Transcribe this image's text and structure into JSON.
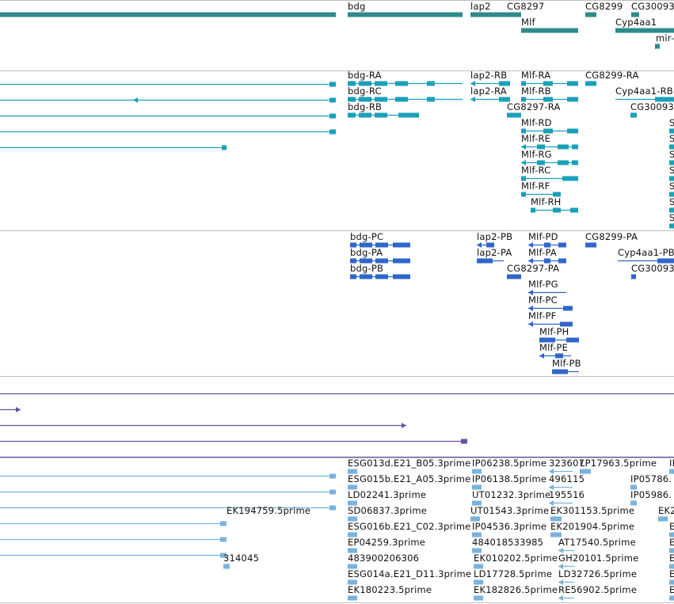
{
  "colors": {
    "gene": "#2e8b8b",
    "transcript": "#1aa0b8",
    "protein": "#2f66c9",
    "rnai": "#6a4fa5",
    "est": "#7ab2dd",
    "divider": "#bdbdbd"
  },
  "tracks": [
    {
      "id": "genes",
      "features": [
        {
          "label": "",
          "lbl": null
        },
        {
          "label": "bdg"
        },
        {
          "label": "lap2"
        },
        {
          "label": "CG8297"
        },
        {
          "label": "CG8299"
        },
        {
          "label": "CG30093"
        },
        {
          "label": "Mlf"
        },
        {
          "label": "Cyp4aa1"
        },
        {
          "label": "mir-"
        }
      ]
    },
    {
      "id": "transcripts",
      "features": [
        {
          "label": "bdg-RA"
        },
        {
          "label": "lap2-RB"
        },
        {
          "label": "Mlf-RA"
        },
        {
          "label": "CG8299-RA"
        },
        {
          "label": "bdg-RC"
        },
        {
          "label": "lap2-RA"
        },
        {
          "label": "Mlf-RB"
        },
        {
          "label": "Cyp4aa1-RB"
        },
        {
          "label": "bdg-RB"
        },
        {
          "label": "CG8297-RA"
        },
        {
          "label": "CG30093"
        },
        {
          "label": "Mlf-RD"
        },
        {
          "label": "Mlf-RE"
        },
        {
          "label": "Mlf-RG"
        },
        {
          "label": "Mlf-RC"
        },
        {
          "label": "Mlf-RF"
        },
        {
          "label": "Mlf-RH"
        },
        {
          "label": "S"
        },
        {
          "label": "S"
        },
        {
          "label": "S"
        },
        {
          "label": "S"
        },
        {
          "label": "S"
        },
        {
          "label": "S"
        },
        {
          "label": "S"
        }
      ]
    },
    {
      "id": "proteins",
      "features": [
        {
          "label": "bdg-PC"
        },
        {
          "label": "lap2-PB"
        },
        {
          "label": "Mlf-PD"
        },
        {
          "label": "CG8299-PA"
        },
        {
          "label": "bdg-PA"
        },
        {
          "label": "lap2-PA"
        },
        {
          "label": "Mlf-PA"
        },
        {
          "label": "Cyp4aa1-PB"
        },
        {
          "label": "bdg-PB"
        },
        {
          "label": "CG8297-PA"
        },
        {
          "label": "CG30093"
        },
        {
          "label": "Mlf-PG"
        },
        {
          "label": "Mlf-PC"
        },
        {
          "label": "Mlf-PF"
        },
        {
          "label": "Mlf-PH"
        },
        {
          "label": "Mlf-PE"
        },
        {
          "label": "Mlf-PB"
        }
      ]
    },
    {
      "id": "rnai",
      "features": []
    },
    {
      "id": "est",
      "features": [
        {
          "label": "ESG013d.E21_B05.3prime"
        },
        {
          "label": "IP06238.5prime"
        },
        {
          "label": "323607"
        },
        {
          "label": "LP17963.5prime"
        },
        {
          "label": "IP"
        },
        {
          "label": "ESG015b.E21_A05.3prime"
        },
        {
          "label": "IP06138.5prime"
        },
        {
          "label": "496115"
        },
        {
          "label": "IP05786."
        },
        {
          "label": "LD02241.3prime"
        },
        {
          "label": "UT01232.3prime"
        },
        {
          "label": "195516"
        },
        {
          "label": "IP05986."
        },
        {
          "label": "EK194759.5prime"
        },
        {
          "label": "SD06837.3prime"
        },
        {
          "label": "UT01543.3prime"
        },
        {
          "label": "EK301153.5prime"
        },
        {
          "label": "EK2"
        },
        {
          "label": "ESG016b.E21_C02.3prime"
        },
        {
          "label": "IP04536.3prime"
        },
        {
          "label": "EK201904.5prime"
        },
        {
          "label": "E"
        },
        {
          "label": "EP04259.3prime"
        },
        {
          "label": "484018533985"
        },
        {
          "label": "AT17540.5prime"
        },
        {
          "label": "E"
        },
        {
          "label": "314045"
        },
        {
          "label": "483900206306"
        },
        {
          "label": "EK010202.5prime"
        },
        {
          "label": "GH20101.5prime"
        },
        {
          "label": "E"
        },
        {
          "label": "ESG014a.E21_D11.3prime"
        },
        {
          "label": "LD17728.5prime"
        },
        {
          "label": "LD32726.5prime"
        },
        {
          "label": "E"
        },
        {
          "label": "EK180223.5prime"
        },
        {
          "label": "EK182826.5prime"
        },
        {
          "label": "RE56902.5prime"
        },
        {
          "label": "E"
        }
      ]
    }
  ]
}
